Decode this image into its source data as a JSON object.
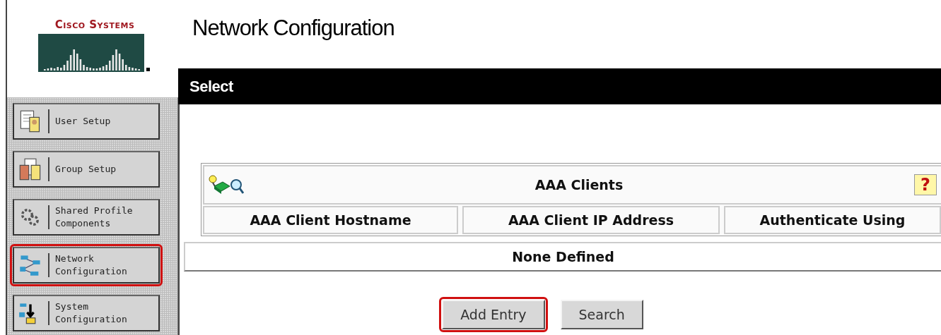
{
  "logo": {
    "text": "Cisco Systems"
  },
  "sidebar": {
    "items": [
      {
        "label": "User Setup",
        "highlighted": false
      },
      {
        "label": "Group Setup",
        "highlighted": false
      },
      {
        "label": "Shared Profile Components",
        "highlighted": false
      },
      {
        "label": "Network Configuration",
        "highlighted": true
      },
      {
        "label": "System Configuration",
        "highlighted": false
      }
    ]
  },
  "page_title": "Network Configuration",
  "section_bar": "Select",
  "table": {
    "title": "AAA Clients",
    "help": "?",
    "columns": [
      "AAA Client Hostname",
      "AAA Client IP Address",
      "Authenticate Using"
    ],
    "empty_text": "None Defined"
  },
  "buttons": [
    {
      "label": "Add Entry",
      "highlighted": true
    },
    {
      "label": "Search",
      "highlighted": false
    }
  ]
}
